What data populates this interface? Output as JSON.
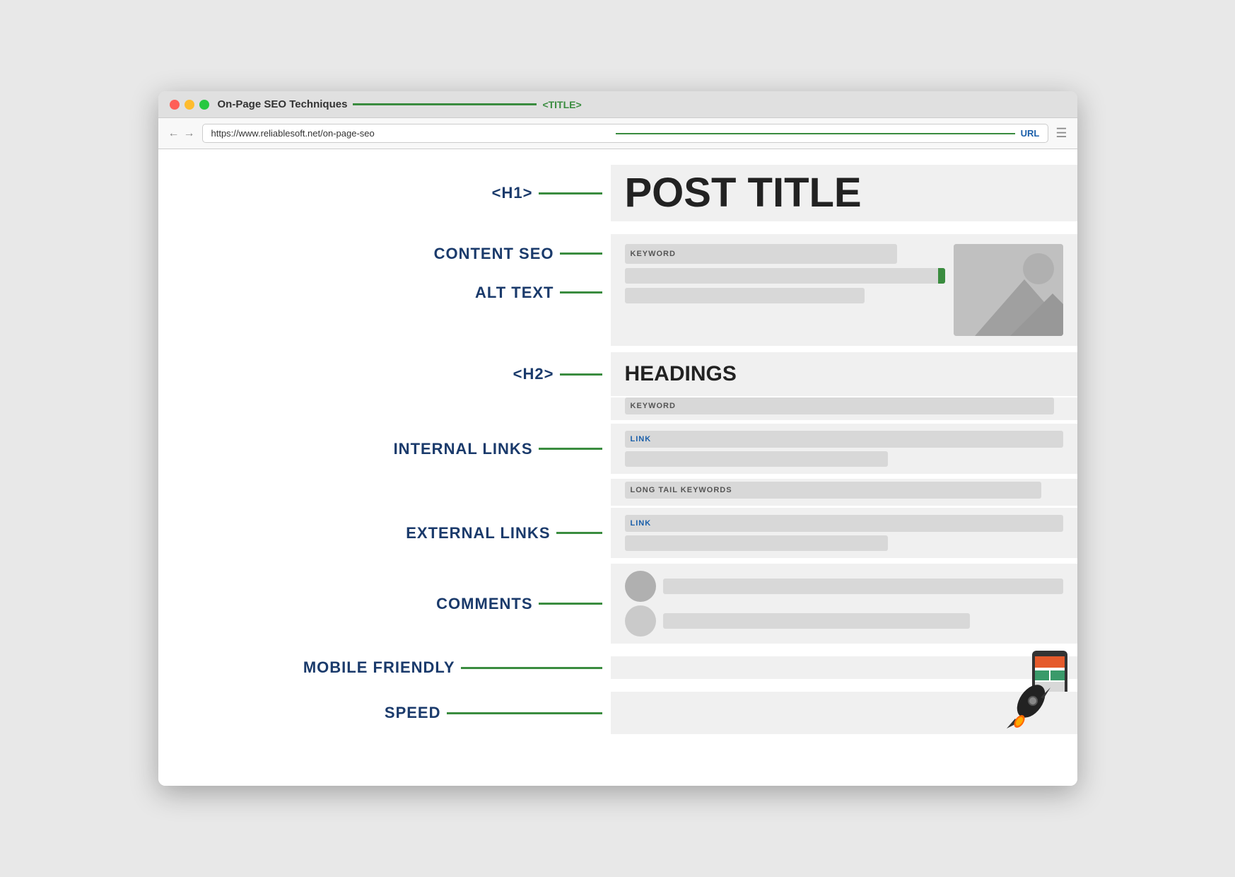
{
  "browser": {
    "title": "On-Page SEO Techniques",
    "title_tag": "<TITLE>",
    "url": "https://www.reliablesoft.net/on-page-seo",
    "url_label": "URL"
  },
  "page": {
    "post_title": "POST TITLE",
    "h1_tag": "<H1>",
    "h2_tag": "<H2>",
    "headings_label": "HEADINGS",
    "content_seo_label": "CONTENT SEO",
    "alt_text_label": "ALT TEXT",
    "internal_links_label": "INTERNAL LINKS",
    "external_links_label": "EXTERNAL LINKS",
    "comments_label": "COMMENTS",
    "mobile_friendly_label": "MOBILE FRIENDLY",
    "speed_label": "SPEED",
    "keyword_text": "KEYWORD",
    "link_text": "LINK",
    "long_tail_keywords_text": "LONG TAIL KEYWORDS"
  },
  "colors": {
    "green": "#3a8c3f",
    "blue_dark": "#1a3a6b",
    "blue_link": "#1a5faa",
    "gray_bar": "#d8d8d8",
    "gray_bg": "#f0f0f0"
  }
}
